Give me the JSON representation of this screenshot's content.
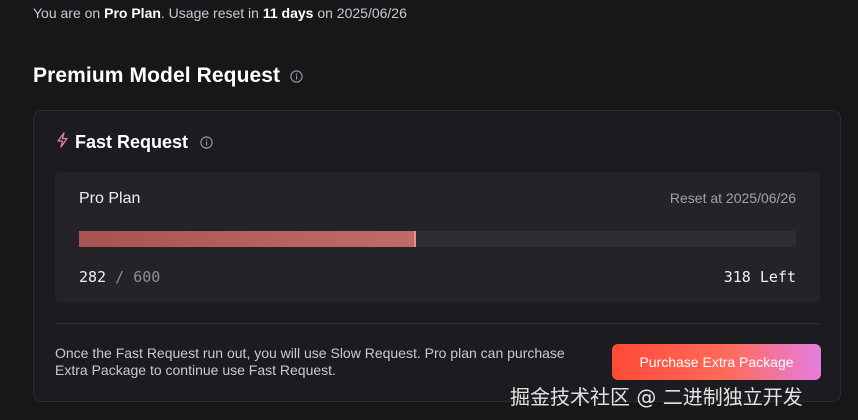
{
  "plan_line": {
    "prefix": "You are on ",
    "plan": "Pro Plan",
    "middle": ". Usage reset in ",
    "days": "11 days",
    "suffix": " on 2025/06/26"
  },
  "section": {
    "title": "Premium Model Request",
    "icon": "info-icon"
  },
  "card": {
    "title": "Fast Request",
    "title_icon": "lightning-icon",
    "info_icon": "info-icon",
    "usage": {
      "plan_name": "Pro Plan",
      "reset_text": "Reset at 2025/06/26",
      "used": "282",
      "separator": "/",
      "total": "600",
      "left_text": "318 Left",
      "used_fraction": 0.47
    },
    "footer_text": "Once the Fast Request run out, you will use Slow Request. Pro plan can purchase Extra Package to continue use Fast Request.",
    "purchase_label": "Purchase Extra Package"
  },
  "colors": {
    "background": "#17171a",
    "card": "#1c1c20",
    "bar_fill": "#b15c5d",
    "accent_gradient_start": "#ff4a38",
    "accent_gradient_end": "#e57de0"
  },
  "watermark": "掘金技术社区 @ 二进制独立开发"
}
